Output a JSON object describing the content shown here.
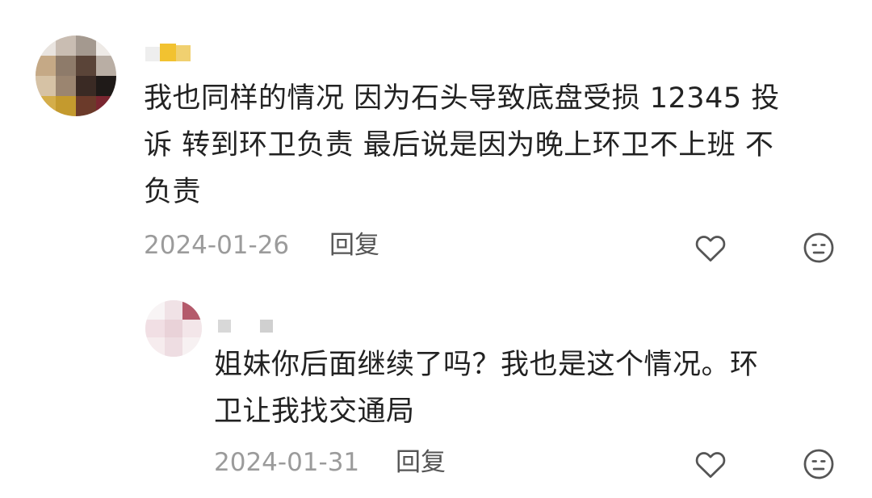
{
  "comments": [
    {
      "text": "我也同样的情况 因为石头导致底盘受损 12345 投\n诉 转到环卫负责 最后说是因为晚上环卫不上班 不\n负责",
      "date": "2024-01-26",
      "reply_label": "回复",
      "like_icon": "heart-outline-icon",
      "dislike_icon": "meh-face-icon"
    },
    {
      "text": "姐妹你后面继续了吗？我也是这个情况。环\n卫让我找交通局",
      "date": "2024-01-31",
      "reply_label": "回复",
      "like_icon": "heart-outline-icon",
      "dislike_icon": "meh-face-icon"
    }
  ],
  "colors": {
    "text": "#222222",
    "meta": "#9b9b9b",
    "reply": "#555555",
    "icon": "#555555"
  }
}
